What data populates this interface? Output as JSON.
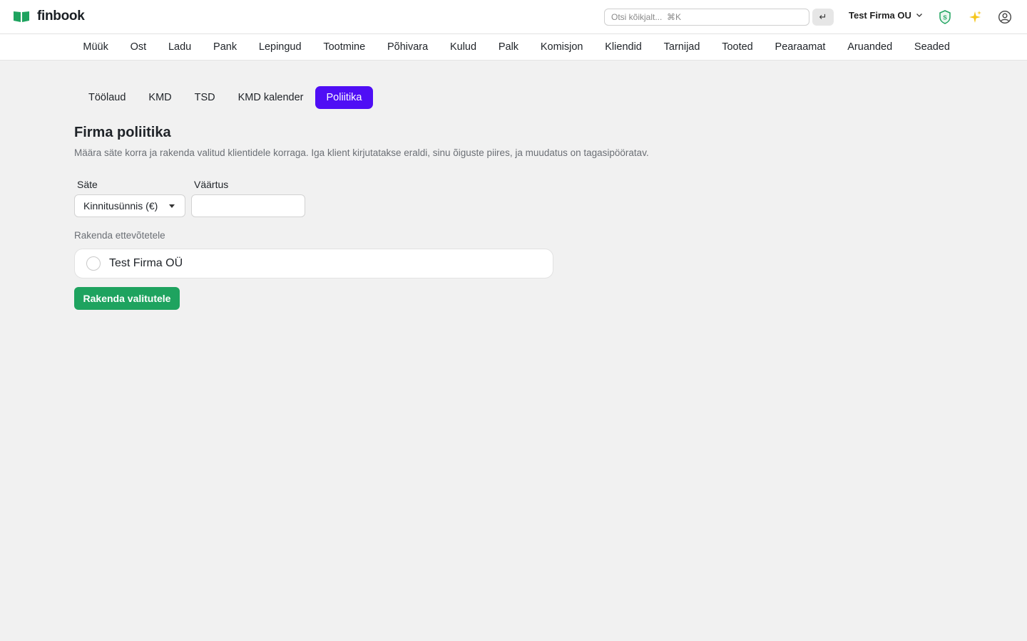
{
  "app": {
    "name": "finbook",
    "brand_color": "#1ea35f",
    "accent_color": "#4f0ef5"
  },
  "header": {
    "search_placeholder": "Otsi kõikjalt...  ⌘K",
    "enter_glyph": "↵",
    "company": "Test Firma OU",
    "icons": [
      "shield-icon",
      "sparkle-icon",
      "user-circle-icon"
    ]
  },
  "modules": [
    "Müük",
    "Ost",
    "Ladu",
    "Pank",
    "Lepingud",
    "Tootmine",
    "Põhivara",
    "Kulud",
    "Palk",
    "Komisjon",
    "Kliendid",
    "Tarnijad",
    "Tooted",
    "Pearaamat",
    "Aruanded",
    "Seaded"
  ],
  "subtabs": {
    "items": [
      "Töölaud",
      "KMD",
      "TSD",
      "KMD kalender",
      "Poliitika"
    ],
    "active": "Poliitika"
  },
  "page": {
    "title": "Firma poliitika",
    "description": "Määra säte korra ja rakenda valitud klientidele korraga. Iga klient kirjutatakse eraldi, sinu õiguste piires, ja muudatus on tagasipööratav."
  },
  "form": {
    "setting_label": "Säte",
    "setting_value": "Kinnitusünnis (€)",
    "value_label": "Väärtus",
    "value_input": "",
    "apply_to_label": "Rakenda ettevõtetele",
    "companies": [
      {
        "name": "Test Firma OÜ",
        "selected": false
      }
    ],
    "apply_button": "Rakenda valitutele"
  }
}
